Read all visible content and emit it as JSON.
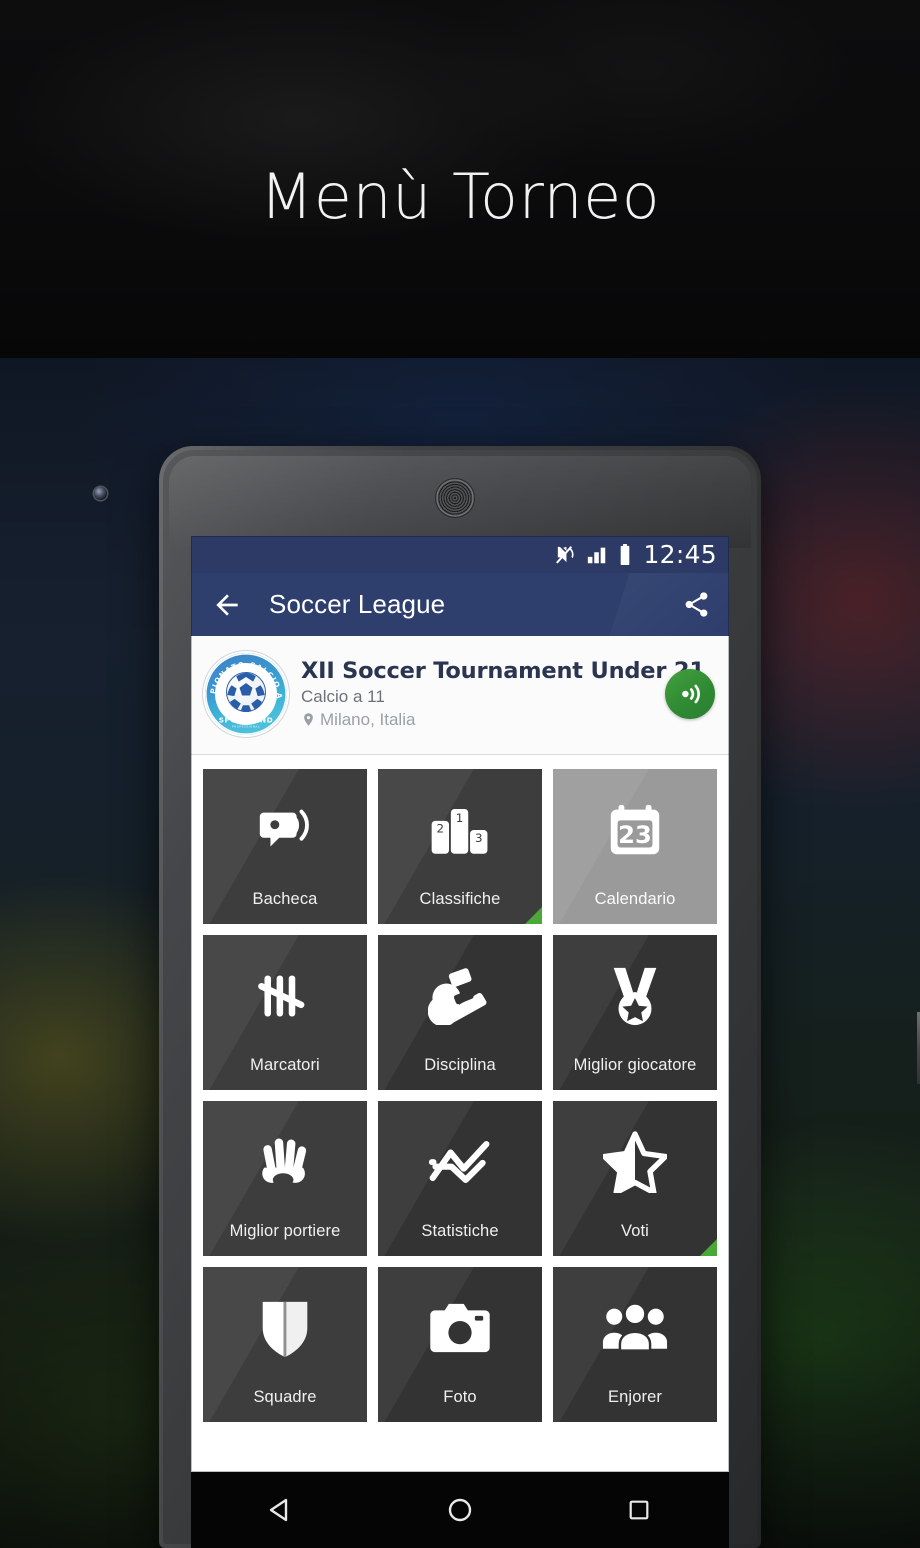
{
  "hero": {
    "title": "Menù Torneo"
  },
  "status_bar": {
    "time": "12:45",
    "icons": [
      "mute-icon",
      "signal-icon",
      "battery-icon"
    ]
  },
  "app_bar": {
    "back_icon": "back-arrow-icon",
    "title": "Soccer League",
    "share_icon": "share-icon"
  },
  "tournament": {
    "logo_text_top": "CAMPIONATO CALCIO A 11",
    "logo_text_bottom": "SPORTLAND",
    "name": "XII Soccer Tournament Under 21",
    "category": "Calcio a 11",
    "location": "Milano, Italia",
    "location_icon": "map-pin-icon",
    "broadcast_icon": "broadcast-icon"
  },
  "menu": {
    "tiles": [
      {
        "label": "Bacheca",
        "icon": "announcement-icon",
        "state": "normal",
        "badge": false
      },
      {
        "label": "Classifiche",
        "icon": "podium-icon",
        "state": "normal",
        "badge": true
      },
      {
        "label": "Calendario",
        "icon": "calendar-icon",
        "state": "pressed",
        "badge": false
      },
      {
        "label": "Marcatori",
        "icon": "tally-marks-icon",
        "state": "normal",
        "badge": false
      },
      {
        "label": "Disciplina",
        "icon": "whistle-cards-icon",
        "state": "alt",
        "badge": false
      },
      {
        "label": "Miglior giocatore",
        "icon": "medal-star-icon",
        "state": "alt",
        "badge": false
      },
      {
        "label": "Miglior portiere",
        "icon": "goalkeeper-glove-icon",
        "state": "normal",
        "badge": false
      },
      {
        "label": "Statistiche",
        "icon": "line-chart-icon",
        "state": "alt",
        "badge": false
      },
      {
        "label": "Voti",
        "icon": "half-star-icon",
        "state": "alt",
        "badge": true
      },
      {
        "label": "Squadre",
        "icon": "shield-icon",
        "state": "normal",
        "badge": false
      },
      {
        "label": "Foto",
        "icon": "camera-icon",
        "state": "alt",
        "badge": false
      },
      {
        "label": "Enjorer",
        "icon": "people-group-icon",
        "state": "alt",
        "badge": false
      }
    ],
    "calendar_day": "23",
    "podium_places": [
      "2",
      "1",
      "3"
    ]
  },
  "nav_bar": {
    "back_label": "back-triangle-icon",
    "home_label": "home-circle-icon",
    "recents_label": "recents-square-icon"
  },
  "colors": {
    "app_bar": "#2e3f6e",
    "status_bar": "#2c3a65",
    "tile": "#3d3d3d",
    "tile_alt": "#333333",
    "tile_pressed": "#9a9a9a",
    "badge_green": "#4aa838",
    "broadcast_green": "#39923a"
  }
}
